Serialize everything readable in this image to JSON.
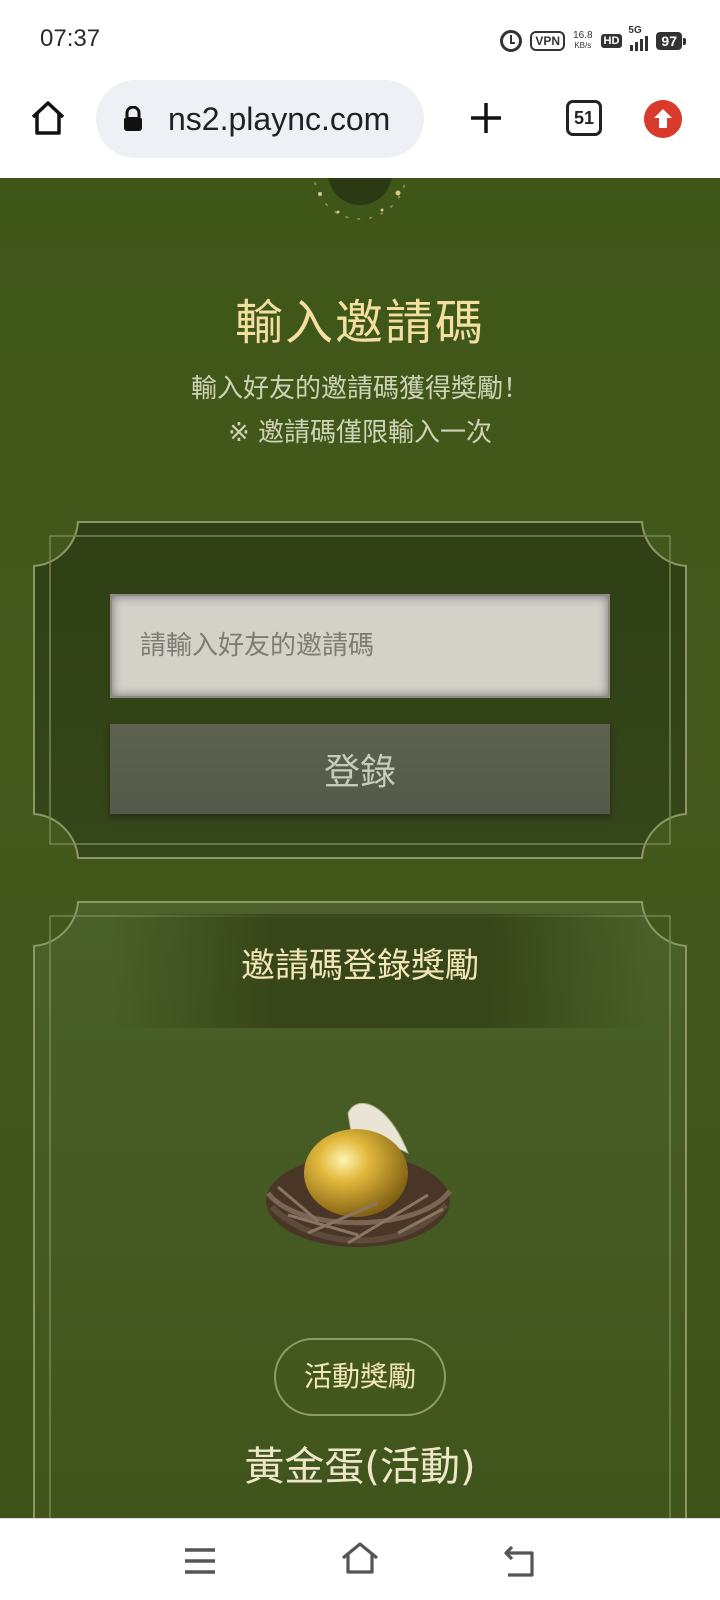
{
  "status_bar": {
    "time": "07:37",
    "vpn": "VPN",
    "speed_value": "16.8",
    "speed_unit": "KB/s",
    "hd": "HD",
    "network": "5G",
    "battery": "97"
  },
  "browser": {
    "url": "ns2.plaync.com",
    "tab_count": "51"
  },
  "page": {
    "title": "輸入邀請碼",
    "subtitle_1": "輸入好友的邀請碼獲得獎勵！",
    "subtitle_2": "※ 邀請碼僅限輸入一次",
    "input_placeholder": "請輸入好友的邀請碼",
    "submit_label": "登錄",
    "reward_heading": "邀請碼登錄獎勵",
    "reward_category": "活動獎勵",
    "reward_item_name": "黃金蛋(活動)",
    "accent_color": "#f3dfa0",
    "background_color": "#3f5419"
  },
  "icons": [
    "home-icon",
    "lock-icon",
    "plus-icon",
    "tabs-icon",
    "update-icon",
    "menu-icon",
    "nav-home-icon",
    "back-icon"
  ]
}
